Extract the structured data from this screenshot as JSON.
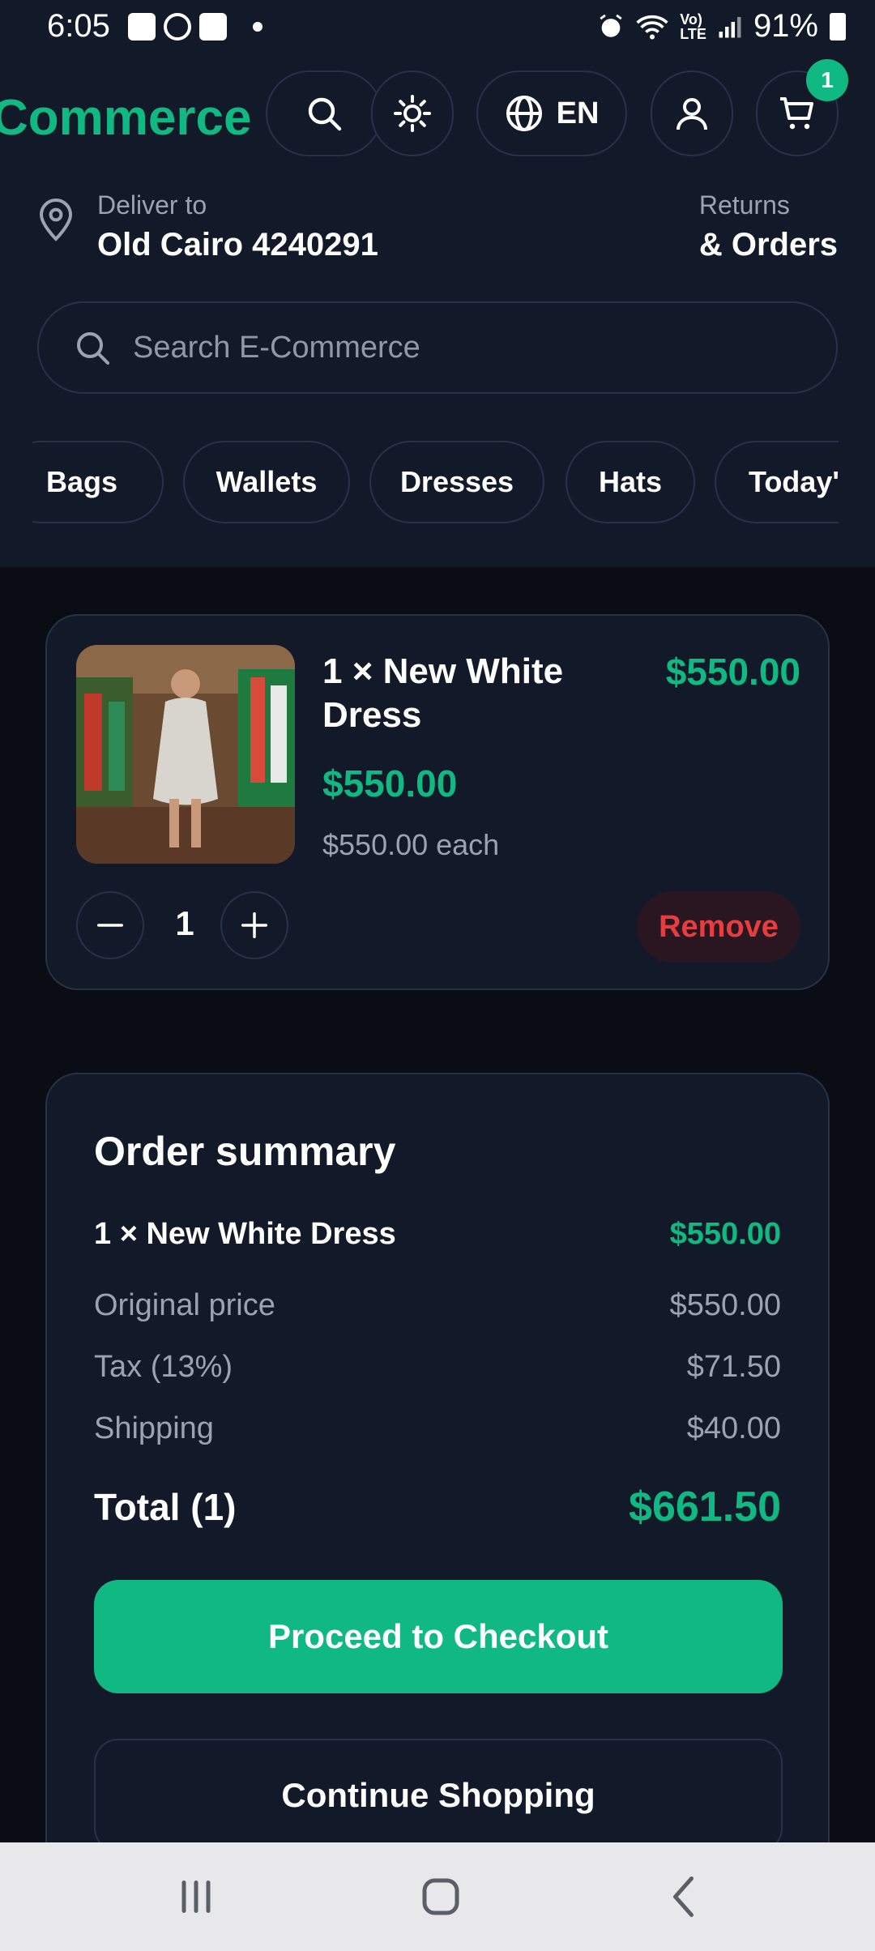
{
  "status_bar": {
    "time": "6:05",
    "battery": "91%",
    "icons": [
      "gallery-icon",
      "sync-icon",
      "youtube-icon",
      "dot-icon",
      "alarm-icon",
      "wifi-icon",
      "volte-icon",
      "signal-icon",
      "battery-icon"
    ]
  },
  "header": {
    "brand": "Commerce",
    "language": "EN",
    "cart_count": "1"
  },
  "delivery": {
    "label": "Deliver to",
    "address": "Old Cairo 4240291",
    "returns_label": "Returns",
    "orders_label": "& Orders"
  },
  "search": {
    "placeholder": "Search E-Commerce"
  },
  "categories": [
    "Bags",
    "Wallets",
    "Dresses",
    "Hats",
    "Today's"
  ],
  "cart_item": {
    "title": "1 × New White Dress",
    "price_top": "$550.00",
    "price": "$550.00",
    "each": "$550.00 each",
    "quantity": "1",
    "remove_label": "Remove"
  },
  "summary": {
    "title": "Order summary",
    "item_label": "1 × New White Dress",
    "item_value": "$550.00",
    "original_label": "Original price",
    "original_value": "$550.00",
    "tax_label": "Tax (13%)",
    "tax_value": "$71.50",
    "shipping_label": "Shipping",
    "shipping_value": "$40.00",
    "total_label": "Total (1)",
    "total_value": "$661.50",
    "checkout_label": "Proceed to Checkout",
    "continue_label": "Continue Shopping"
  },
  "colors": {
    "accent": "#10b981",
    "background": "#0a0d14",
    "surface": "#121a2a",
    "border": "#273246",
    "danger": "#e53e3e"
  }
}
